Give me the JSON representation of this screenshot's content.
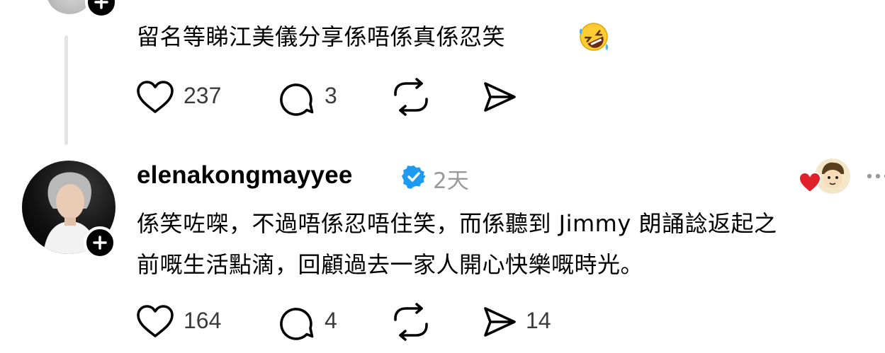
{
  "post1": {
    "text": "留名等睇江美儀分享係唔係真係忍笑",
    "emoji_icon": "rofl-emoji-icon",
    "likes": "237",
    "comments": "3"
  },
  "post2": {
    "username": "elenakongmayyee",
    "time": "2天",
    "line1": "係笑咗㗎，不過唔係忍唔住笑，而係聽到 Jimmy 朗誦諗返起之",
    "line2": "前嘅生活點滴，回顧過去一家人開心快樂嘅時光。",
    "likes": "164",
    "comments": "4",
    "shares": "14"
  },
  "colors": {
    "verified": "#1d9bf0",
    "heart": "#e0202b",
    "icon_stroke": "#000000"
  }
}
